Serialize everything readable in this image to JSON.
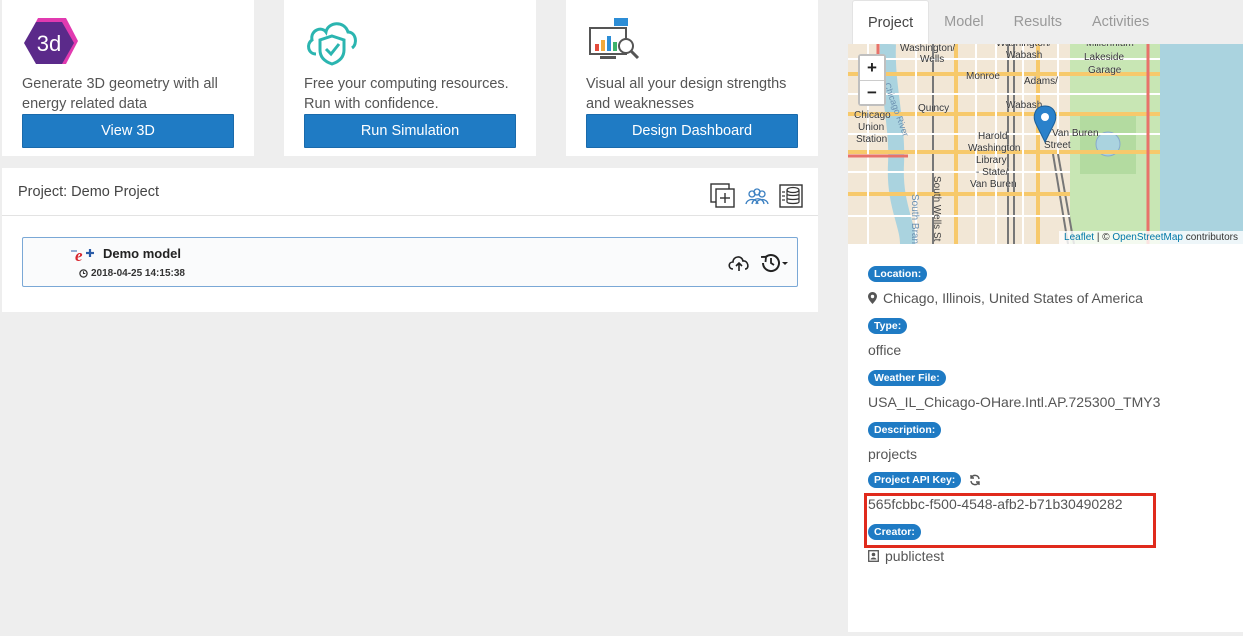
{
  "cards": [
    {
      "icon": "3d-hexagon-icon",
      "icon_text": "3d",
      "text": "Generate 3D geometry with all energy related data",
      "button": "View 3D"
    },
    {
      "icon": "cloud-shield-icon",
      "text": "Free your computing resources. Run with confidence.",
      "button": "Run Simulation"
    },
    {
      "icon": "dashboard-chart-icon",
      "text": "Visual all your design strengths and weaknesses",
      "button": "Design Dashboard"
    }
  ],
  "project": {
    "title": "Project: Demo Project",
    "tools": [
      "add-model-icon",
      "team-icon",
      "database-icon"
    ],
    "model": {
      "name": "Demo model",
      "timestamp": "2018-04-25 14:15:38"
    }
  },
  "tabs": [
    {
      "label": "Project",
      "active": true
    },
    {
      "label": "Model",
      "active": false
    },
    {
      "label": "Results",
      "active": false
    },
    {
      "label": "Activities",
      "active": false
    }
  ],
  "map": {
    "zoom_in": "+",
    "zoom_out": "−",
    "attribution_leaflet": "Leaflet",
    "attribution_sep": "| ©",
    "attribution_osm": "OpenStreetMap",
    "attribution_tail": "contributors",
    "street_labels": [
      "Washington/Wells",
      "Washington/Wabash",
      "Millennium Lakeside Garage",
      "Monroe",
      "Adams/Wabash",
      "Quincy",
      "Chicago Union Station",
      "Harold Washington Library",
      "Van Buren Street",
      "State/Van Buren",
      "South Wells St",
      "South Branch"
    ]
  },
  "details": {
    "location_label": "Location:",
    "location": "Chicago, Illinois, United States of America",
    "type_label": "Type:",
    "type": "office",
    "weather_label": "Weather File:",
    "weather": "USA_IL_Chicago-OHare.Intl.AP.725300_TMY3",
    "description_label": "Description:",
    "description": "projects",
    "api_label": "Project API Key:",
    "api_key": "565fcbbc-f500-4548-afb2-b71b30490282",
    "creator_label": "Creator:",
    "creator": "publictest"
  },
  "colors": {
    "primary": "#1f7bc4",
    "highlight": "#e02a1c"
  }
}
